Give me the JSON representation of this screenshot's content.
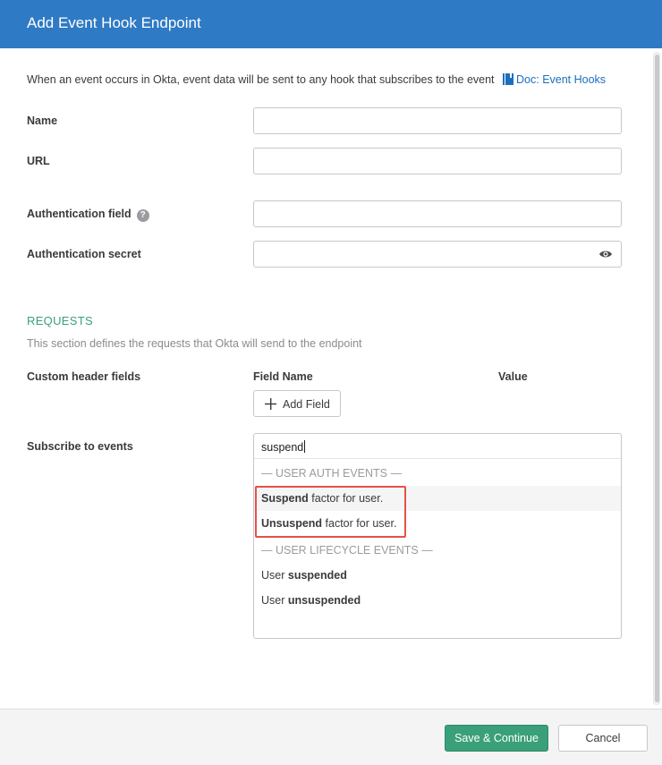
{
  "header": {
    "title": "Add Event Hook Endpoint"
  },
  "intro": {
    "text": "When an event occurs in Okta, event data will be sent to any hook that subscribes to the event",
    "doc_link": "Doc: Event Hooks"
  },
  "form": {
    "name_label": "Name",
    "name_value": "",
    "url_label": "URL",
    "url_value": "",
    "auth_field_label": "Authentication field",
    "auth_field_value": "",
    "auth_secret_label": "Authentication secret",
    "auth_secret_value": ""
  },
  "requests": {
    "title": "REQUESTS",
    "description": "This section defines the requests that Okta will send to the endpoint",
    "custom_header_label": "Custom header fields",
    "field_name_header": "Field Name",
    "value_header": "Value",
    "add_field_label": "Add Field"
  },
  "subscribe": {
    "label": "Subscribe to events",
    "search_value": "suspend",
    "groups": [
      {
        "name": "— USER AUTH EVENTS —",
        "options": [
          {
            "bold": "Suspend",
            "rest": " factor for user."
          },
          {
            "bold": "Unsuspend",
            "rest": " factor for user."
          }
        ]
      },
      {
        "name": "— USER LIFECYCLE EVENTS —",
        "options": [
          {
            "pre": "User ",
            "bold": "suspended"
          },
          {
            "pre": "User ",
            "bold": "unsuspended"
          }
        ]
      }
    ]
  },
  "footer": {
    "save_label": "Save & Continue",
    "cancel_label": "Cancel"
  },
  "colors": {
    "header_bg": "#2f7ac4",
    "accent_green": "#3aa07a",
    "link_blue": "#1a6fbf",
    "highlight_red": "#e4514a"
  }
}
